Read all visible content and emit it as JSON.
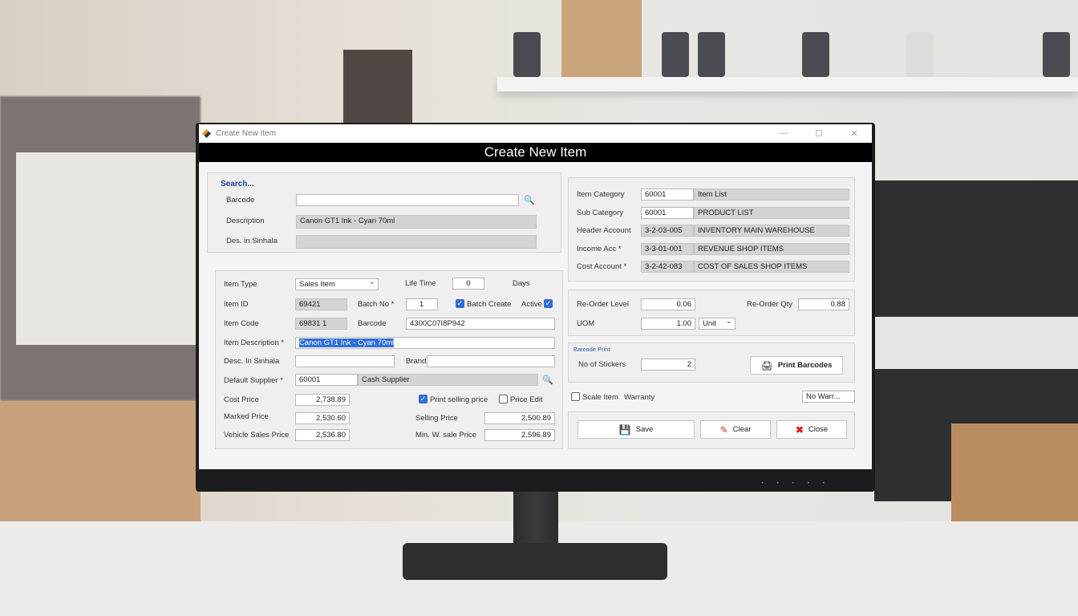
{
  "window": {
    "title": "Create New Item",
    "heading": "Create New Item",
    "min": "—",
    "max": "☐",
    "close": "✕"
  },
  "search": {
    "heading": "Search...",
    "barcode_label": "Barcode",
    "barcode_value": "",
    "description_label": "Description",
    "description_value": "Canon GT1 Ink - Cyan 70ml",
    "desc_sinhala_label": "Des. in Sinhala",
    "desc_sinhala_value": ""
  },
  "item": {
    "item_type_label": "Item Type",
    "item_type_value": "Sales Item",
    "life_time_label": "Life Time",
    "life_time_value": "0",
    "days_label": "Days",
    "item_id_label": "Item ID",
    "item_id_value": "69421",
    "batch_no_label": "Batch No *",
    "batch_no_value": "1",
    "batch_create_label": "Batch Create",
    "batch_create_checked": true,
    "active_label": "Active",
    "active_checked": true,
    "item_code_label": "Item Code",
    "item_code_value": "69831 1",
    "barcode_label": "Barcode",
    "barcode_value": "4300C07I8P942",
    "item_description_label": "Item Description *",
    "item_description_value": "Canon GT1 Ink - Cyan 70ml",
    "desc_sinhala_label": "Desc. In Sinhala",
    "desc_sinhala_value": "",
    "brand_label": "Brand",
    "brand_value": "",
    "default_supplier_label": "Default Supplier *",
    "default_supplier_code": "60001",
    "default_supplier_name": "Cash Supplier",
    "cost_price_label": "Cost Price",
    "cost_price_value": "2,738.89",
    "print_selling_price_label": "Print selling price",
    "print_selling_price_checked": true,
    "price_edit_label": "Price Edit",
    "price_edit_checked": false,
    "marked_price_label": "Marked Price",
    "marked_price_value": "2,530.60",
    "selling_price_label": "Selling Price",
    "selling_price_value": "2,500.89",
    "vehicle_sales_price_label": "Vehicle Sales Price",
    "vehicle_sales_price_value": "2,536.80",
    "min_ws_price_label": "Min. W. sale Price",
    "min_ws_price_value": "2,596.89"
  },
  "accounts": {
    "item_category_label": "Item Category",
    "item_category_code": "60001",
    "item_category_name": "Item List",
    "sub_category_label": "Sub Category",
    "sub_category_code": "60001",
    "sub_category_name": "PRODUCT LIST",
    "header_account_label": "Header Account",
    "header_account_code": "3-2-03-005",
    "header_account_name": "INVENTORY MAIN WAREHOUSE",
    "income_acc_label": "Income Acc *",
    "income_acc_code": "3-3-01-001",
    "income_acc_name": "REVENUE SHOP ITEMS",
    "cost_account_label": "Cost Account *",
    "cost_account_code": "3-2-42-083",
    "cost_account_name": "COST OF SALES SHOP ITEMS"
  },
  "reorder": {
    "reorder_level_label": "Re-Order Level",
    "reorder_level_value": "0.06",
    "reorder_qty_label": "Re-Order Qty",
    "reorder_qty_value": "0.88",
    "uom_label": "UOM",
    "uom_value": "1.00",
    "uom_unit": "Unit"
  },
  "barcode_print": {
    "heading": "Barcode Print",
    "no_of_stickers_label": "No of Stickers",
    "no_of_stickers_value": "2",
    "print_barcodes_label": "Print Barcodes"
  },
  "warranty": {
    "scale_item_label": "Scale Item",
    "scale_item_checked": false,
    "warranty_label": "Warranty",
    "warranty_value": "No Warr..."
  },
  "actions": {
    "save_label": "Save",
    "clear_label": "Clear",
    "close_label": "Close"
  },
  "colors": {
    "accent": "#2f6fd6",
    "title_bar": "#000000",
    "readonly_field": "#d4d4d6",
    "search_heading": "#1f3d9b"
  }
}
